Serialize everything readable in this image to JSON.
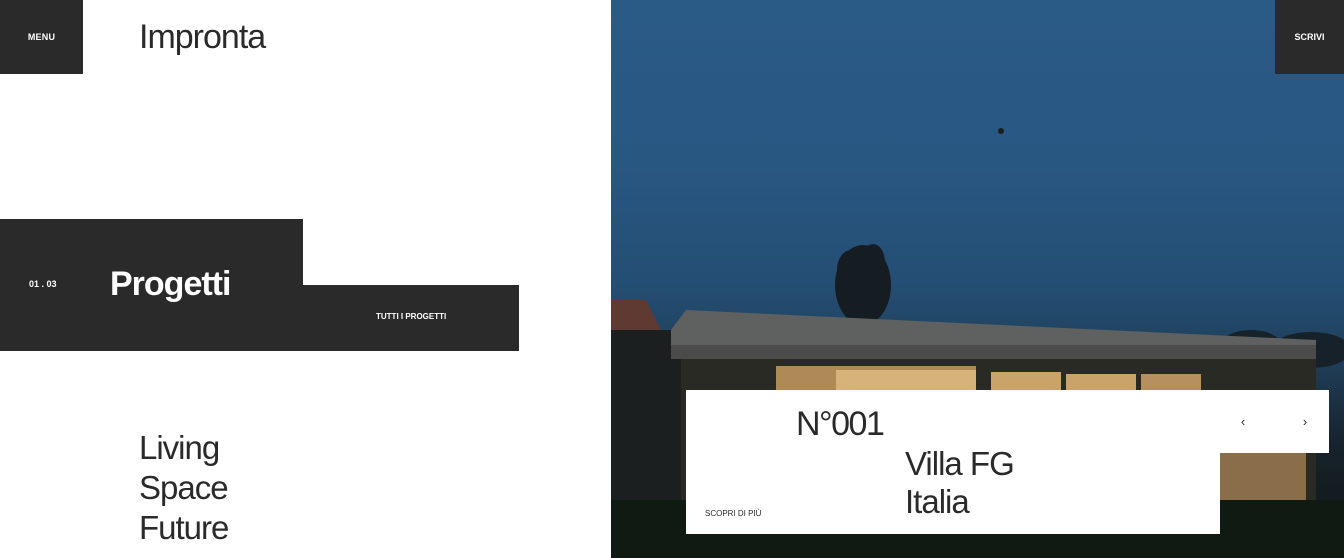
{
  "header": {
    "menu_label": "MENU",
    "brand": "Impronta",
    "contact_label": "SCRIVI"
  },
  "projects": {
    "counter": "01 . 03",
    "title": "Progetti",
    "all_projects_label": "TUTTI I PROGETTI"
  },
  "tagline": [
    "Living",
    "Space",
    "Future"
  ],
  "featured": {
    "number": "N°001",
    "name": "Villa FG",
    "location": "Italia",
    "discover_label": "SCOPRI DI PIÙ",
    "prev_icon": "‹",
    "next_icon": "›"
  },
  "colors": {
    "dark": "#2a2a2a",
    "sky": "#285782",
    "white": "#ffffff"
  }
}
